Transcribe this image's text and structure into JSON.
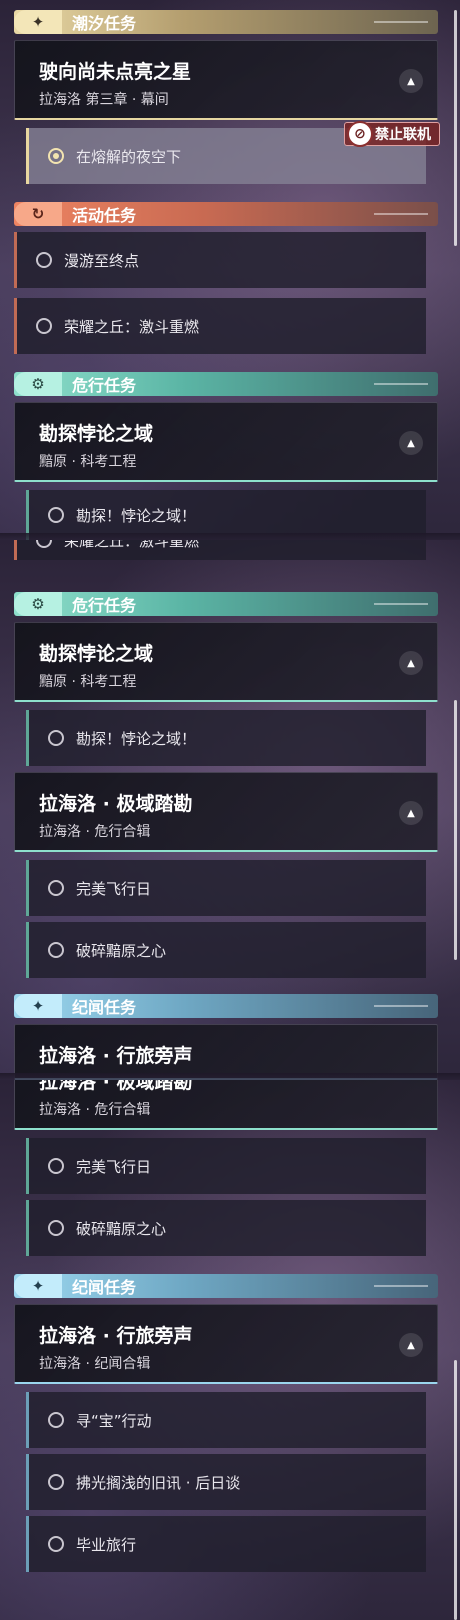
{
  "panel1": {
    "tide": {
      "title": "潮汐任务",
      "icon": "sparkle-icon"
    },
    "tide_card": {
      "title": "驶向尚未点亮之星",
      "sub": "拉海洛 第三章 · 幕间"
    },
    "tide_sub": {
      "label": "在熔解的夜空下"
    },
    "badge": {
      "label": "禁止联机",
      "icon": "no-coop-icon"
    },
    "activity": {
      "title": "活动任务",
      "icon": "refresh-icon"
    },
    "activity_subs": [
      {
        "label": "漫游至终点"
      },
      {
        "label": "荣耀之丘：激斗重燃"
      }
    ],
    "danger": {
      "title": "危行任务",
      "icon": "gear-icon"
    },
    "danger_card": {
      "title": "勘探悖论之域",
      "sub": "黯原 · 科考工程"
    },
    "partial_sub": "勘探！悖论之域！"
  },
  "panel2": {
    "partial_sub": "荣耀之丘：激斗重燃",
    "danger": {
      "title": "危行任务",
      "icon": "gear-icon"
    },
    "danger_card": {
      "title": "勘探悖论之域",
      "sub": "黯原 · 科考工程"
    },
    "danger_sub": {
      "label": "勘探！悖论之域！"
    },
    "danger_card2": {
      "title": "拉海洛 · 极域踏勘",
      "sub": "拉海洛 · 危行合辑"
    },
    "danger_subs2": [
      {
        "label": "完美飞行日"
      },
      {
        "label": "破碎黯原之心"
      }
    ],
    "lore": {
      "title": "纪闻任务",
      "icon": "sparkle-icon"
    },
    "partial_card": "拉海洛 · 行旅旁声"
  },
  "panel3": {
    "partial_card_title": "拉海洛 · 极域踏勘",
    "partial_card_sub": "拉海洛 · 危行合辑",
    "danger_subs": [
      {
        "label": "完美飞行日"
      },
      {
        "label": "破碎黯原之心"
      }
    ],
    "lore": {
      "title": "纪闻任务",
      "icon": "sparkle-icon"
    },
    "lore_card": {
      "title": "拉海洛 · 行旅旁声",
      "sub": "拉海洛 · 纪闻合辑"
    },
    "lore_subs": [
      {
        "label": "寻“宝”行动"
      },
      {
        "label": "拂光搁浅的旧讯 · 后日谈"
      },
      {
        "label": "毕业旅行"
      }
    ]
  }
}
